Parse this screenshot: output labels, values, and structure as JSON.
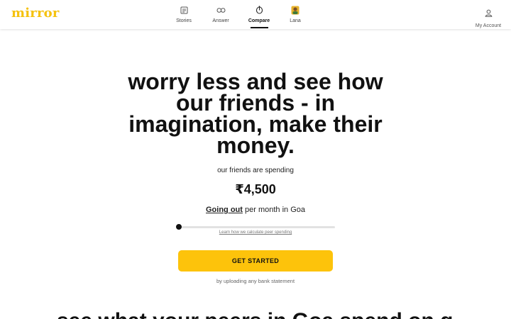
{
  "header": {
    "logo": "mirror",
    "nav": [
      {
        "label": "Stories",
        "icon": "stories-icon",
        "active": false
      },
      {
        "label": "Answer",
        "icon": "answer-icon",
        "active": false
      },
      {
        "label": "Compare",
        "icon": "compare-icon",
        "active": true
      },
      {
        "label": "Lana",
        "icon": "lana-avatar-icon",
        "active": false
      }
    ],
    "account": {
      "label": "My Account",
      "icon": "user-icon"
    }
  },
  "hero": {
    "title": "worry less and see how our friends - in imagination, make their money.",
    "subtitle": "our friends are spending",
    "amount": "₹4,500",
    "category": "Going out",
    "category_suffix": " per month in Goa",
    "slider_value_fraction": 0,
    "learn_link": "Learn how we calculate peer spending",
    "cta_label": "GET STARTED",
    "cta_note": "by uploading any bank statement"
  },
  "next_section": {
    "heading": "see what your peers in Goa spend on going out"
  },
  "colors": {
    "brand_yellow": "#f5c20f",
    "button_yellow": "#fdc30b",
    "text": "#111111"
  }
}
